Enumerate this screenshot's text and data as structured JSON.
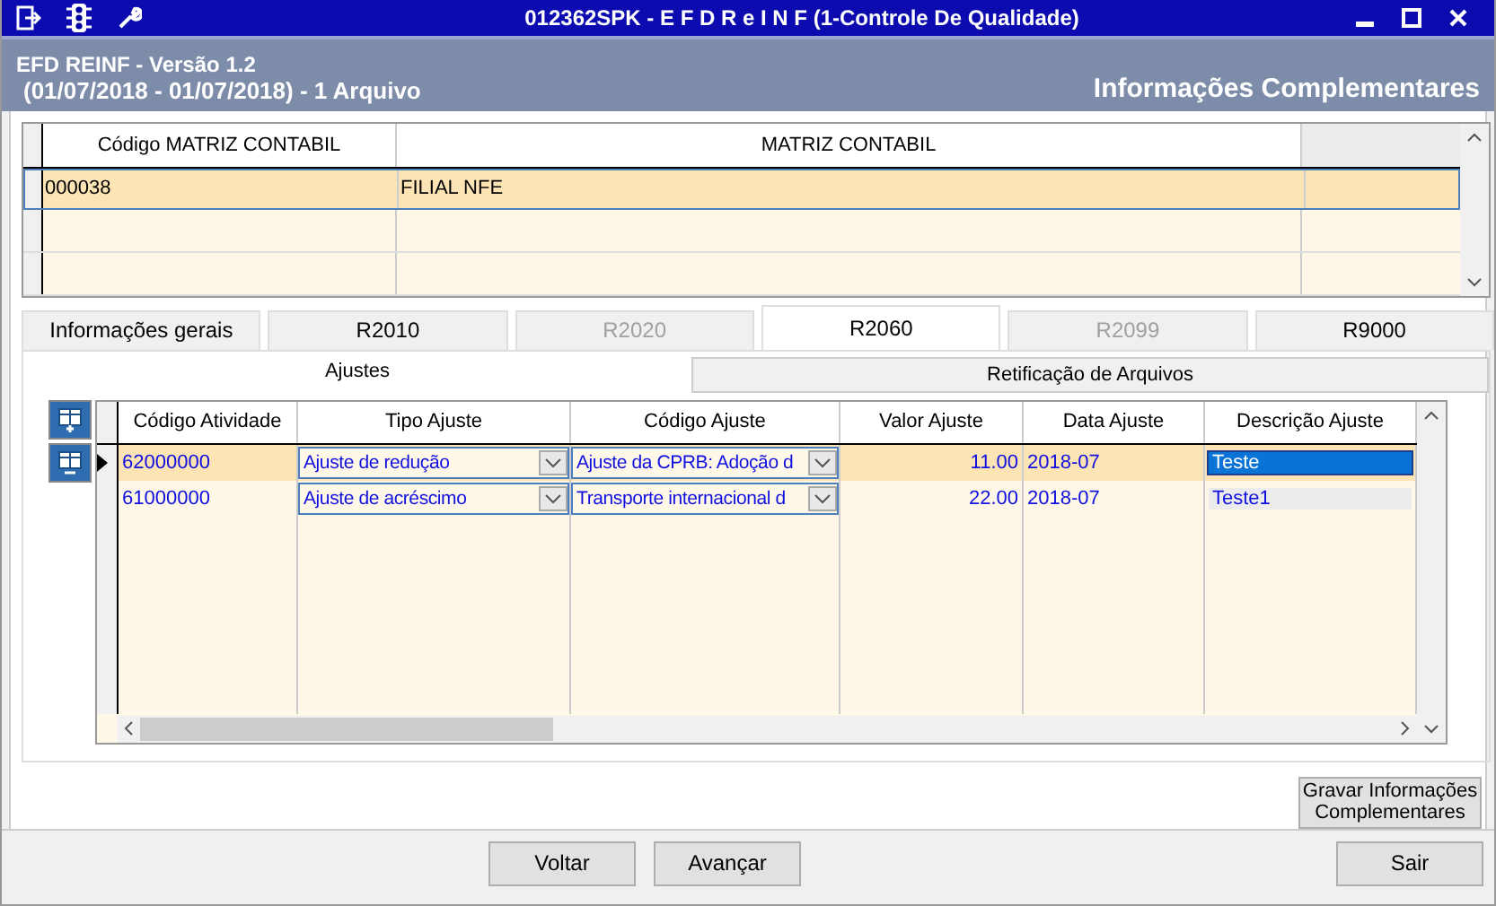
{
  "window": {
    "title": "012362SPK - E F D   R e I N F (1-Controle De Qualidade)"
  },
  "header": {
    "app": "EFD REINF - Versão 1.2",
    "period": "(01/07/2018 - 01/07/2018) - 1 Arquivo",
    "page_title": "Informações Complementares"
  },
  "matrix_table": {
    "columns": [
      "Código MATRIZ CONTABIL",
      "MATRIZ CONTABIL"
    ],
    "rows": [
      {
        "code": "000038",
        "name": "FILIAL NFE",
        "selected": true
      }
    ]
  },
  "tabs": [
    {
      "label": "Informações gerais",
      "selected": false,
      "disabled": false
    },
    {
      "label": "R2010",
      "selected": false,
      "disabled": false
    },
    {
      "label": "R2020",
      "selected": false,
      "disabled": true
    },
    {
      "label": "R2060",
      "selected": true,
      "disabled": false
    },
    {
      "label": "R2099",
      "selected": false,
      "disabled": true
    },
    {
      "label": "R9000",
      "selected": false,
      "disabled": false
    }
  ],
  "subtabs": [
    {
      "label": "Ajustes",
      "selected": true
    },
    {
      "label": "Retificação de Arquivos",
      "selected": false
    }
  ],
  "adjustments": {
    "columns": [
      "Código Atividade",
      "Tipo Ajuste",
      "Código Ajuste",
      "Valor Ajuste",
      "Data Ajuste",
      "Descrição Ajuste"
    ],
    "rows": [
      {
        "activity": "62000000",
        "type": "Ajuste de redução",
        "code": "Ajuste da CPRB: Adoção d",
        "value": "11.00",
        "date": "2018-07",
        "description": "Teste",
        "selected": true
      },
      {
        "activity": "61000000",
        "type": "Ajuste de acréscimo",
        "code": "Transporte internacional d",
        "value": "22.00",
        "date": "2018-07",
        "description": "Teste1",
        "selected": false
      }
    ]
  },
  "save_button": [
    "Gravar Informações",
    "Complementares"
  ],
  "footer_buttons": [
    "Voltar",
    "Avançar"
  ],
  "exit_button": "Sair"
}
